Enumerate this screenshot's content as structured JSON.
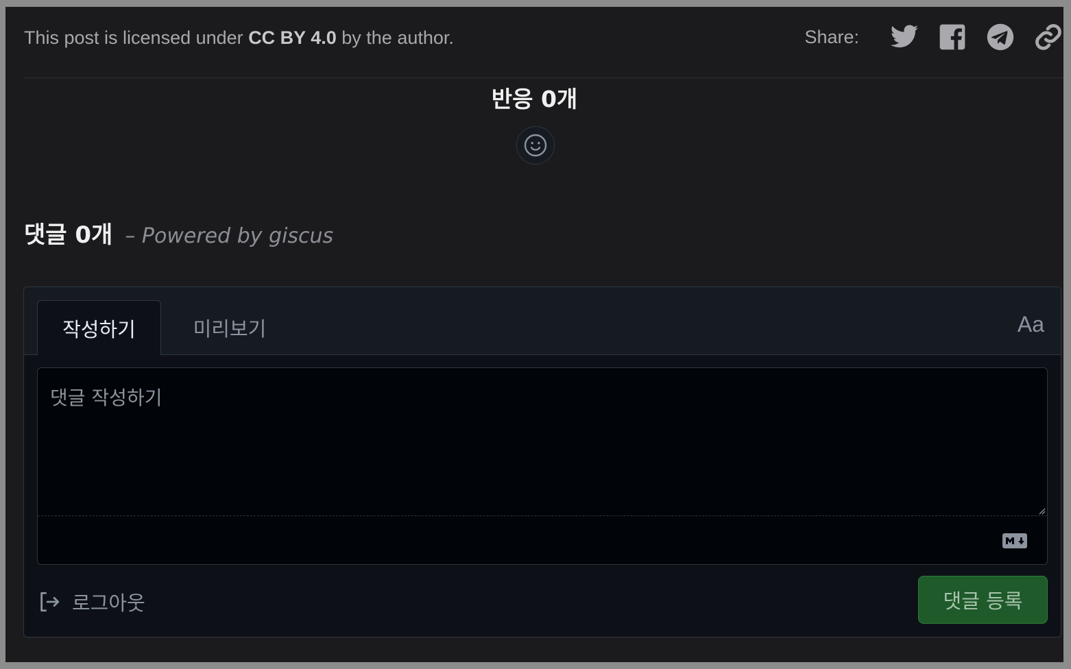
{
  "license": {
    "prefix": "This post is licensed under",
    "license_name": "CC BY 4.0",
    "suffix": "by the author."
  },
  "share": {
    "label": "Share:",
    "icons": [
      "twitter-icon",
      "facebook-icon",
      "telegram-icon",
      "link-icon"
    ]
  },
  "reactions": {
    "title": "반응 0개",
    "icon": "smiley-icon"
  },
  "comments": {
    "count_label": "댓글 0개",
    "powered_by": "– Powered by giscus"
  },
  "editor": {
    "tabs": [
      {
        "label": "작성하기",
        "active": true
      },
      {
        "label": "미리보기",
        "active": false
      }
    ],
    "font_toggle": "Aa",
    "placeholder": "댓글 작성하기",
    "value": "",
    "markdown_icon": "markdown-icon",
    "logout_label": "로그아웃",
    "submit_label": "댓글 등록"
  },
  "colors": {
    "background": "#1b1b1e",
    "editor_bg": "#0d1117",
    "submit_bg": "#1f5a2a",
    "border": "#30363d"
  }
}
